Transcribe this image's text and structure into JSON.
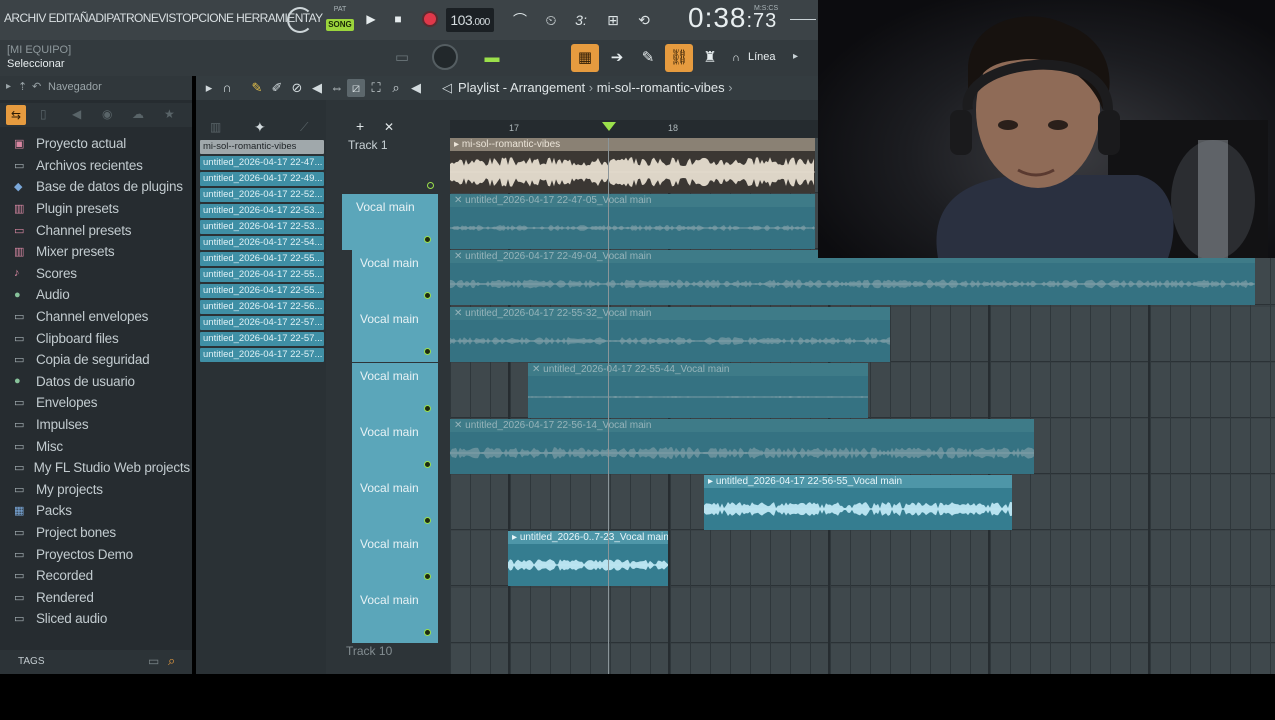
{
  "menu": {
    "text": "ARCHIV EDITAÑADIPATRONEVISTOPCIONE HERRAMIENTAY"
  },
  "transport": {
    "pat_label": "PAT",
    "song_label": "SONG",
    "play": "▶",
    "stop": "■",
    "tempo": "103",
    "tempo_decimal": ".000",
    "time_main": "0:38",
    "time_ms": ":73",
    "time_format": "M:S:CS"
  },
  "row2": {
    "equipo": "[MI EQUIPO]",
    "hint": "Seleccionar",
    "snap_mode": "Línea"
  },
  "browser": {
    "title": "Navegador",
    "items": [
      {
        "label": "Proyecto actual",
        "icon": "project-icon"
      },
      {
        "label": "Archivos recientes",
        "icon": "folder-icon"
      },
      {
        "label": "Base de datos de plugins",
        "icon": "plugin-db-icon"
      },
      {
        "label": "Plugin presets",
        "icon": "plugin-presets-icon"
      },
      {
        "label": "Channel presets",
        "icon": "channel-presets-icon"
      },
      {
        "label": "Mixer presets",
        "icon": "mixer-presets-icon"
      },
      {
        "label": "Scores",
        "icon": "note-icon"
      },
      {
        "label": "Audio",
        "icon": "audio-icon"
      },
      {
        "label": "Channel envelopes",
        "icon": "folder-icon"
      },
      {
        "label": "Clipboard files",
        "icon": "folder-icon"
      },
      {
        "label": "Copia de seguridad",
        "icon": "folder-icon"
      },
      {
        "label": "Datos de usuario",
        "icon": "user-icon"
      },
      {
        "label": "Envelopes",
        "icon": "folder-icon"
      },
      {
        "label": "Impulses",
        "icon": "folder-icon"
      },
      {
        "label": "Misc",
        "icon": "folder-icon"
      },
      {
        "label": "My FL Studio Web projects",
        "icon": "folder-icon"
      },
      {
        "label": "My projects",
        "icon": "folder-icon"
      },
      {
        "label": "Packs",
        "icon": "packs-icon"
      },
      {
        "label": "Project bones",
        "icon": "folder-icon"
      },
      {
        "label": "Proyectos Demo",
        "icon": "folder-icon"
      },
      {
        "label": "Recorded",
        "icon": "folder-icon"
      },
      {
        "label": "Rendered",
        "icon": "folder-icon"
      },
      {
        "label": "Sliced audio",
        "icon": "folder-icon"
      }
    ],
    "tags_label": "TAGS"
  },
  "playlist": {
    "title": "Playlist - Arrangement",
    "pattern": "mi-sol--romantic-vibes",
    "clip_list": [
      "mi-sol--romantic-vibes",
      "untitled_2026-04-17 22-47...",
      "untitled_2026-04-17 22-49...",
      "untitled_2026-04-17 22-52...",
      "untitled_2026-04-17 22-53...",
      "untitled_2026-04-17 22-53...",
      "untitled_2026-04-17 22-54...",
      "untitled_2026-04-17 22-55...",
      "untitled_2026-04-17 22-55...",
      "untitled_2026-04-17 22-55...",
      "untitled_2026-04-17 22-56...",
      "untitled_2026-04-17 22-57...",
      "untitled_2026-04-17 22-57...",
      "untitled_2026-04-17 22-57..."
    ],
    "ruler": {
      "bar_a": "17",
      "bar_b": "18"
    },
    "track1": "Track 1",
    "track10": "Track 10",
    "tracks": [
      {
        "name": "Vocal main"
      },
      {
        "name": "Vocal main"
      },
      {
        "name": "Vocal main"
      },
      {
        "name": "Vocal main"
      },
      {
        "name": "Vocal main"
      },
      {
        "name": "Vocal main"
      },
      {
        "name": "Vocal main"
      },
      {
        "name": "Vocal main"
      }
    ],
    "clips": [
      {
        "label": "mi-sol--romantic-vibes",
        "kind": "audio"
      },
      {
        "label": "untitled_2026-04-17 22-47-05_Vocal main",
        "kind": "muted"
      },
      {
        "label": "untitled_2026-04-17 22-49-04_Vocal main",
        "kind": "muted"
      },
      {
        "label": "untitled_2026-04-17 22-55-32_Vocal main",
        "kind": "muted"
      },
      {
        "label": "untitled_2026-04-17 22-55-44_Vocal main",
        "kind": "muted"
      },
      {
        "label": "untitled_2026-04-17 22-56-14_Vocal main",
        "kind": "muted"
      },
      {
        "label": "untitled_2026-04-17 22-56-55_Vocal main",
        "kind": "active"
      },
      {
        "label": "untitled_2026-0..7-23_Vocal main",
        "kind": "active"
      }
    ]
  }
}
